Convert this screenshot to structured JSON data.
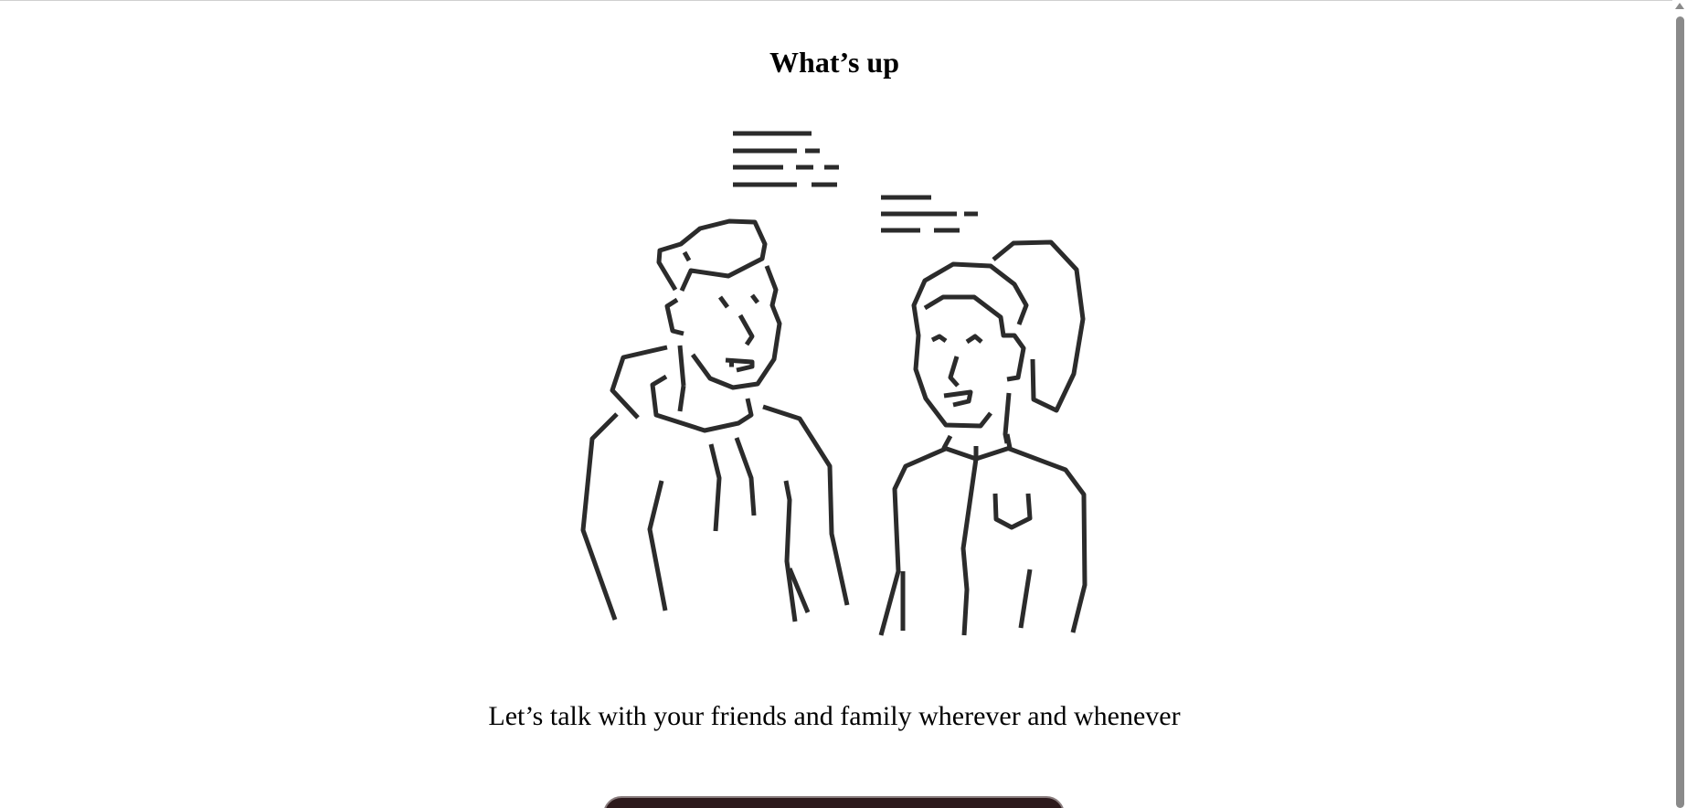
{
  "header": {
    "title": "What’s up"
  },
  "illustration": {
    "icon": "friends-chatting-illustration"
  },
  "main": {
    "tagline": "Let’s talk with your friends and family wherever and whenever"
  },
  "cta": {
    "color": "#2d1a1c"
  }
}
